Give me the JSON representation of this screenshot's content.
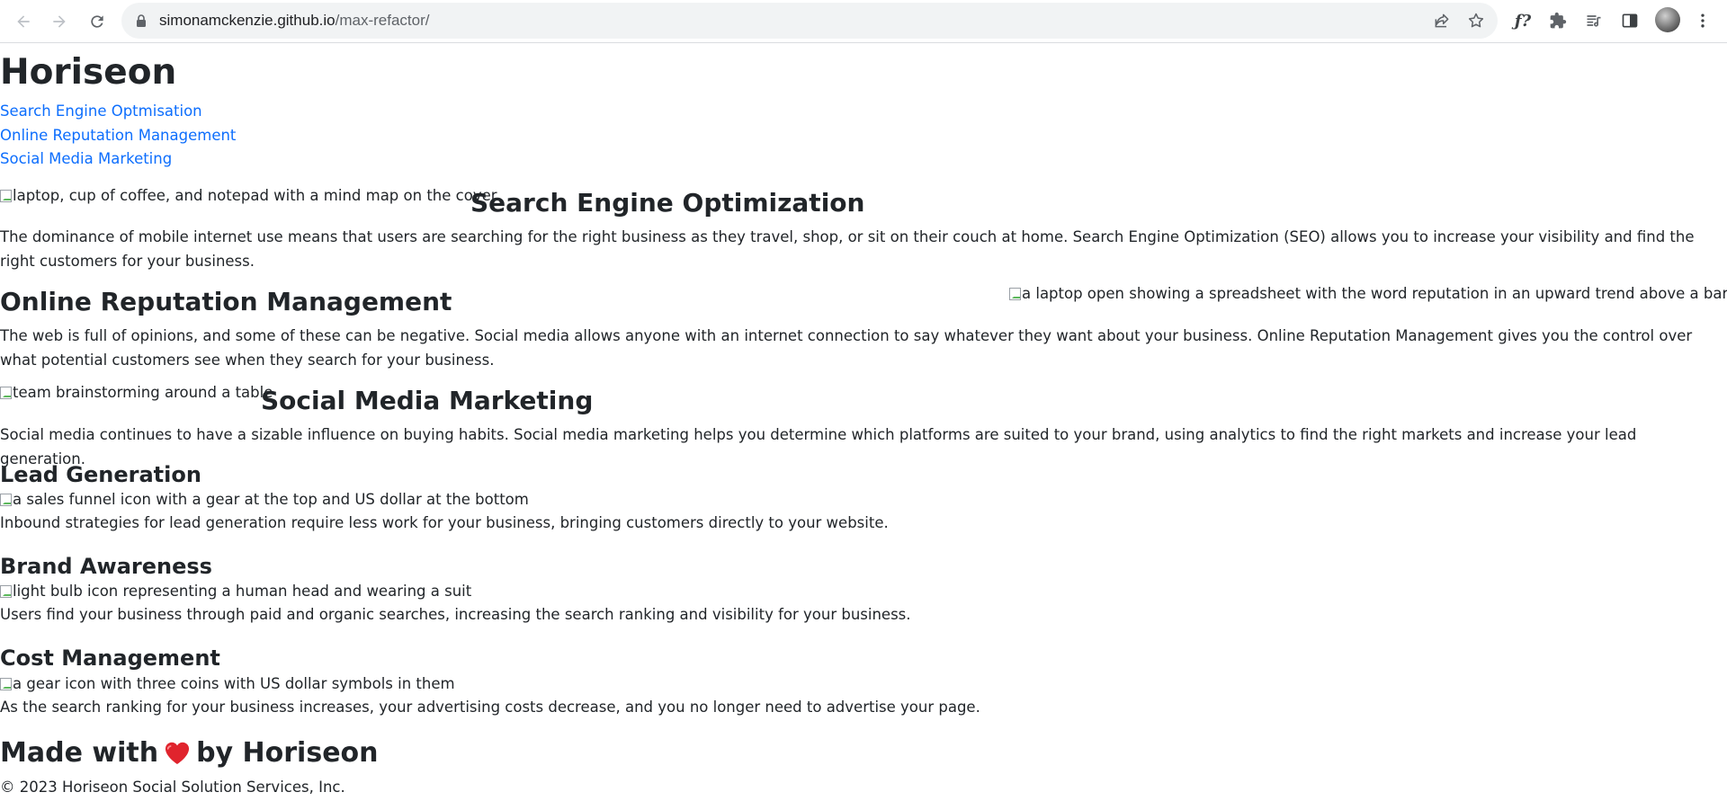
{
  "browser": {
    "url_host": "simonamckenzie.github.io",
    "url_path": "/max-refactor/"
  },
  "site": {
    "title": "Horiseon",
    "nav": [
      "Search Engine Optmisation",
      "Online Reputation Management",
      "Social Media Marketing"
    ]
  },
  "sections": {
    "seo": {
      "image_alt": "laptop, cup of coffee, and notepad with a mind map on the cover",
      "heading": "Search Engine Optimization",
      "text": "The dominance of mobile internet use means that users are searching for the right business as they travel, shop, or sit on their couch at home. Search Engine Optimization (SEO) allows you to increase your visibility and find the right customers for your business."
    },
    "orm": {
      "image_alt": "a laptop open showing a spreadsheet with the word reputation in an upward trend above a bar chart",
      "heading": "Online Reputation Management",
      "text": "The web is full of opinions, and some of these can be negative. Social media allows anyone with an internet connection to say whatever they want about your business. Online Reputation Management gives you the control over what potential customers see when they search for your business."
    },
    "smm": {
      "image_alt": "team brainstorming around a table",
      "heading": "Social Media Marketing",
      "text": "Social media continues to have a sizable influence on buying habits. Social media marketing helps you determine which platforms are suited to your brand, using analytics to find the right markets and increase your lead generation."
    }
  },
  "benefits": {
    "lead": {
      "heading": "Lead Generation",
      "image_alt": "a sales funnel icon with a gear at the top and US dollar at the bottom",
      "text": "Inbound strategies for lead generation require less work for your business, bringing customers directly to your website."
    },
    "brand": {
      "heading": "Brand Awareness",
      "image_alt": "light bulb icon representing a human head and wearing a suit",
      "text": "Users find your business through paid and organic searches, increasing the search ranking and visibility for your business."
    },
    "cost": {
      "heading": "Cost Management",
      "image_alt": "a gear icon with three coins with US dollar symbols in them",
      "text": "As the search ranking for your business increases, your advertising costs decrease, and you no longer need to advertise your page."
    }
  },
  "footer": {
    "made_with": "Made with",
    "by": "by Horiseon",
    "copyright": "© 2023 Horiseon Social Solution Services, Inc."
  },
  "icons": {
    "back": "arrow-left-icon",
    "forward": "arrow-right-icon",
    "reload": "reload-icon",
    "lock": "lock-icon",
    "share": "share-icon",
    "bookmark": "star-icon",
    "fx": "fx-icon",
    "extensions": "puzzle-icon",
    "media": "media-queue-icon",
    "sidepanel": "side-panel-icon",
    "menu": "kebab-menu-icon",
    "heart": "heart-icon"
  },
  "colors": {
    "link": "#0d6efd",
    "text": "#212529",
    "heart": "#e0242d"
  }
}
